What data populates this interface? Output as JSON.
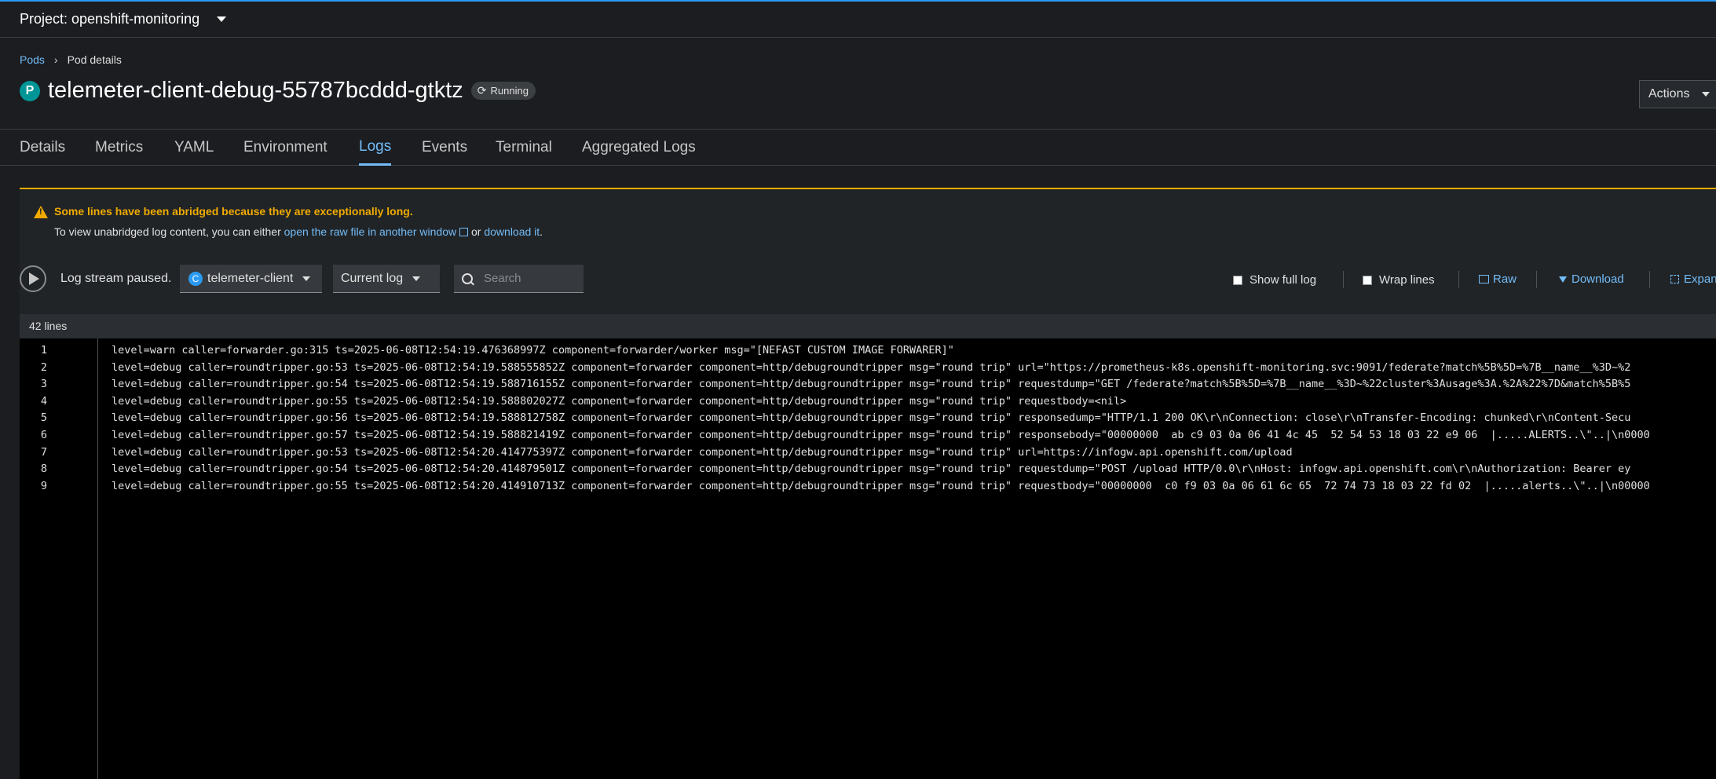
{
  "project": {
    "label": "Project: openshift-monitoring"
  },
  "breadcrumb": {
    "root": "Pods",
    "separator": "›",
    "current": "Pod details"
  },
  "pod": {
    "badge": "P",
    "name": "telemeter-client-debug-55787bcddd-gtktz",
    "status": "Running"
  },
  "actions": {
    "label": "Actions"
  },
  "tabs": [
    "Details",
    "Metrics",
    "YAML",
    "Environment",
    "Logs",
    "Events",
    "Terminal",
    "Aggregated Logs"
  ],
  "active_tab": "Logs",
  "alert": {
    "title": "Some lines have been abridged because they are exceptionally long.",
    "body_prefix": "To view unabridged log content, you can either ",
    "link_raw": "open the raw file in another window",
    "body_mid": " or ",
    "link_download": "download it",
    "body_suffix": "."
  },
  "toolbar": {
    "status": "Log stream paused.",
    "container_badge": "C",
    "container": "telemeter-client",
    "log_select": "Current log",
    "search_placeholder": "Search",
    "show_full_log": "Show full log",
    "wrap_lines": "Wrap lines",
    "raw": "Raw",
    "download": "Download",
    "expand": "Expand"
  },
  "log": {
    "line_count": "42 lines",
    "lines": [
      {
        "n": "1",
        "text": "level=warn caller=forwarder.go:315 ts=2025-06-08T12:54:19.476368997Z component=forwarder/worker msg=\"[NEFAST CUSTOM IMAGE FORWARER]\""
      },
      {
        "n": "2",
        "text": "level=debug caller=roundtripper.go:53 ts=2025-06-08T12:54:19.588555852Z component=forwarder component=http/debugroundtripper msg=\"round trip\" url=\"https://prometheus-k8s.openshift-monitoring.svc:9091/federate?match%5B%5D=%7B__name__%3D~%2"
      },
      {
        "n": "3",
        "text": "level=debug caller=roundtripper.go:54 ts=2025-06-08T12:54:19.588716155Z component=forwarder component=http/debugroundtripper msg=\"round trip\" requestdump=\"GET /federate?match%5B%5D=%7B__name__%3D~%22cluster%3Ausage%3A.%2A%22%7D&match%5B%5"
      },
      {
        "n": "4",
        "text": "level=debug caller=roundtripper.go:55 ts=2025-06-08T12:54:19.588802027Z component=forwarder component=http/debugroundtripper msg=\"round trip\" requestbody=<nil>"
      },
      {
        "n": "5",
        "text": "level=debug caller=roundtripper.go:56 ts=2025-06-08T12:54:19.588812758Z component=forwarder component=http/debugroundtripper msg=\"round trip\" responsedump=\"HTTP/1.1 200 OK\\r\\nConnection: close\\r\\nTransfer-Encoding: chunked\\r\\nContent-Secu"
      },
      {
        "n": "6",
        "text": "level=debug caller=roundtripper.go:57 ts=2025-06-08T12:54:19.588821419Z component=forwarder component=http/debugroundtripper msg=\"round trip\" responsebody=\"00000000  ab c9 03 0a 06 41 4c 45  52 54 53 18 03 22 e9 06  |.....ALERTS..\\\"..|\\n0000"
      },
      {
        "n": "7",
        "text": "level=debug caller=roundtripper.go:53 ts=2025-06-08T12:54:20.414775397Z component=forwarder component=http/debugroundtripper msg=\"round trip\" url=https://infogw.api.openshift.com/upload"
      },
      {
        "n": "8",
        "text": "level=debug caller=roundtripper.go:54 ts=2025-06-08T12:54:20.414879501Z component=forwarder component=http/debugroundtripper msg=\"round trip\" requestdump=\"POST /upload HTTP/0.0\\r\\nHost: infogw.api.openshift.com\\r\\nAuthorization: Bearer ey"
      },
      {
        "n": "9",
        "text": "level=debug caller=roundtripper.go:55 ts=2025-06-08T12:54:20.414910713Z component=forwarder component=http/debugroundtripper msg=\"round trip\" requestbody=\"00000000  c0 f9 03 0a 06 61 6c 65  72 74 73 18 03 22 fd 02  |.....alerts..\\\"..|\\n00000"
      }
    ]
  }
}
